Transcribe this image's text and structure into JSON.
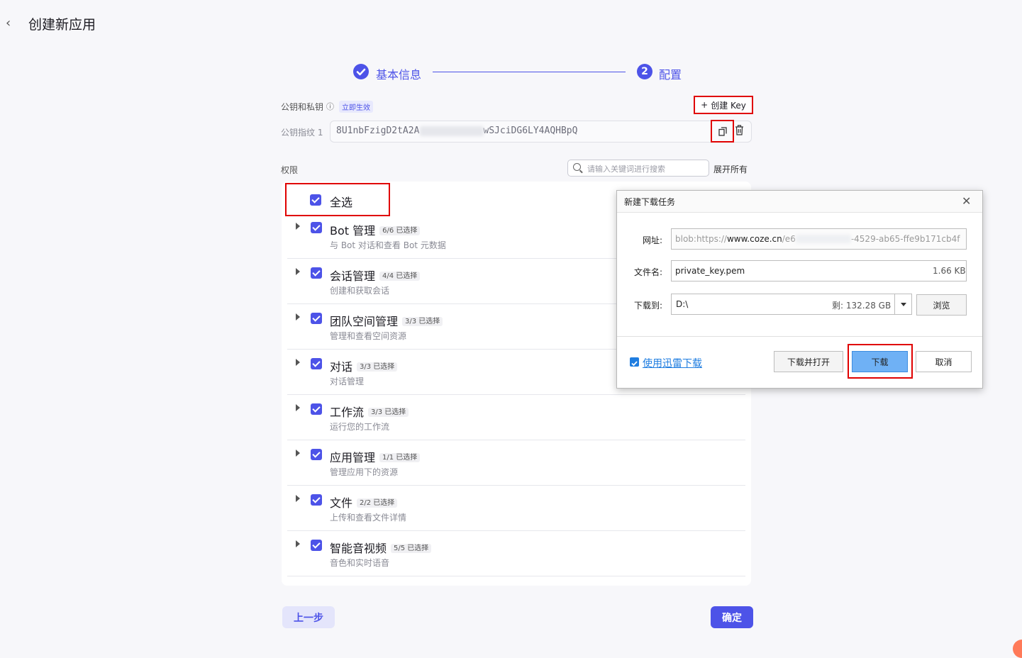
{
  "header": {
    "back_icon": "‹",
    "title": "创建新应用"
  },
  "steps": [
    {
      "label": "基本信息",
      "state": "done"
    },
    {
      "number": "2",
      "label": "配置",
      "state": "active"
    }
  ],
  "keys": {
    "section_label": "公钥和私钥",
    "info_icon": "ⓘ",
    "badge": "立即生效",
    "create_key_plus": "+",
    "create_key_label": "创建 Key",
    "fingerprint_label": "公钥指纹 1",
    "fingerprint_start": "8U1nbFzigD2tA2A",
    "fingerprint_end": "wSJciDG6LY4AQHBpQ"
  },
  "permissions": {
    "label": "权限",
    "search_placeholder": "请输入关键词进行搜索",
    "expand_all": "展开所有",
    "select_all": "全选",
    "items": [
      {
        "title": "Bot 管理",
        "tag": "6/6 已选择",
        "desc": "与 Bot 对话和查看 Bot 元数据"
      },
      {
        "title": "会话管理",
        "tag": "4/4 已选择",
        "desc": "创建和获取会话"
      },
      {
        "title": "团队空间管理",
        "tag": "3/3 已选择",
        "desc": "管理和查看空间资源"
      },
      {
        "title": "对话",
        "tag": "3/3 已选择",
        "desc": "对话管理"
      },
      {
        "title": "工作流",
        "tag": "3/3 已选择",
        "desc": "运行您的工作流"
      },
      {
        "title": "应用管理",
        "tag": "1/1 已选择",
        "desc": "管理应用下的资源"
      },
      {
        "title": "文件",
        "tag": "2/2 已选择",
        "desc": "上传和查看文件详情"
      },
      {
        "title": "智能音视频",
        "tag": "5/5 已选择",
        "desc": "音色和实时语音"
      }
    ]
  },
  "footer": {
    "prev": "上一步",
    "confirm": "确定"
  },
  "dialog": {
    "title": "新建下载任务",
    "close": "✕",
    "url_label": "网址:",
    "url_prefix": "blob:https://",
    "url_host": "www.coze.cn",
    "url_path_start": "/e6",
    "url_path_end": "-4529-ab65-ffe9b171cb4f",
    "filename_label": "文件名:",
    "filename": "private_key.pem",
    "filesize": "1.66 KB",
    "saveto_label": "下载到:",
    "saveto": "D:\\",
    "free_space": "剩: 132.28 GB",
    "browse": "浏览",
    "thunder": "使用迅雷下载",
    "download_open": "下载并打开",
    "download": "下载",
    "cancel": "取消"
  },
  "colors": {
    "accent": "#4d53e8",
    "highlight": "#e00000"
  }
}
